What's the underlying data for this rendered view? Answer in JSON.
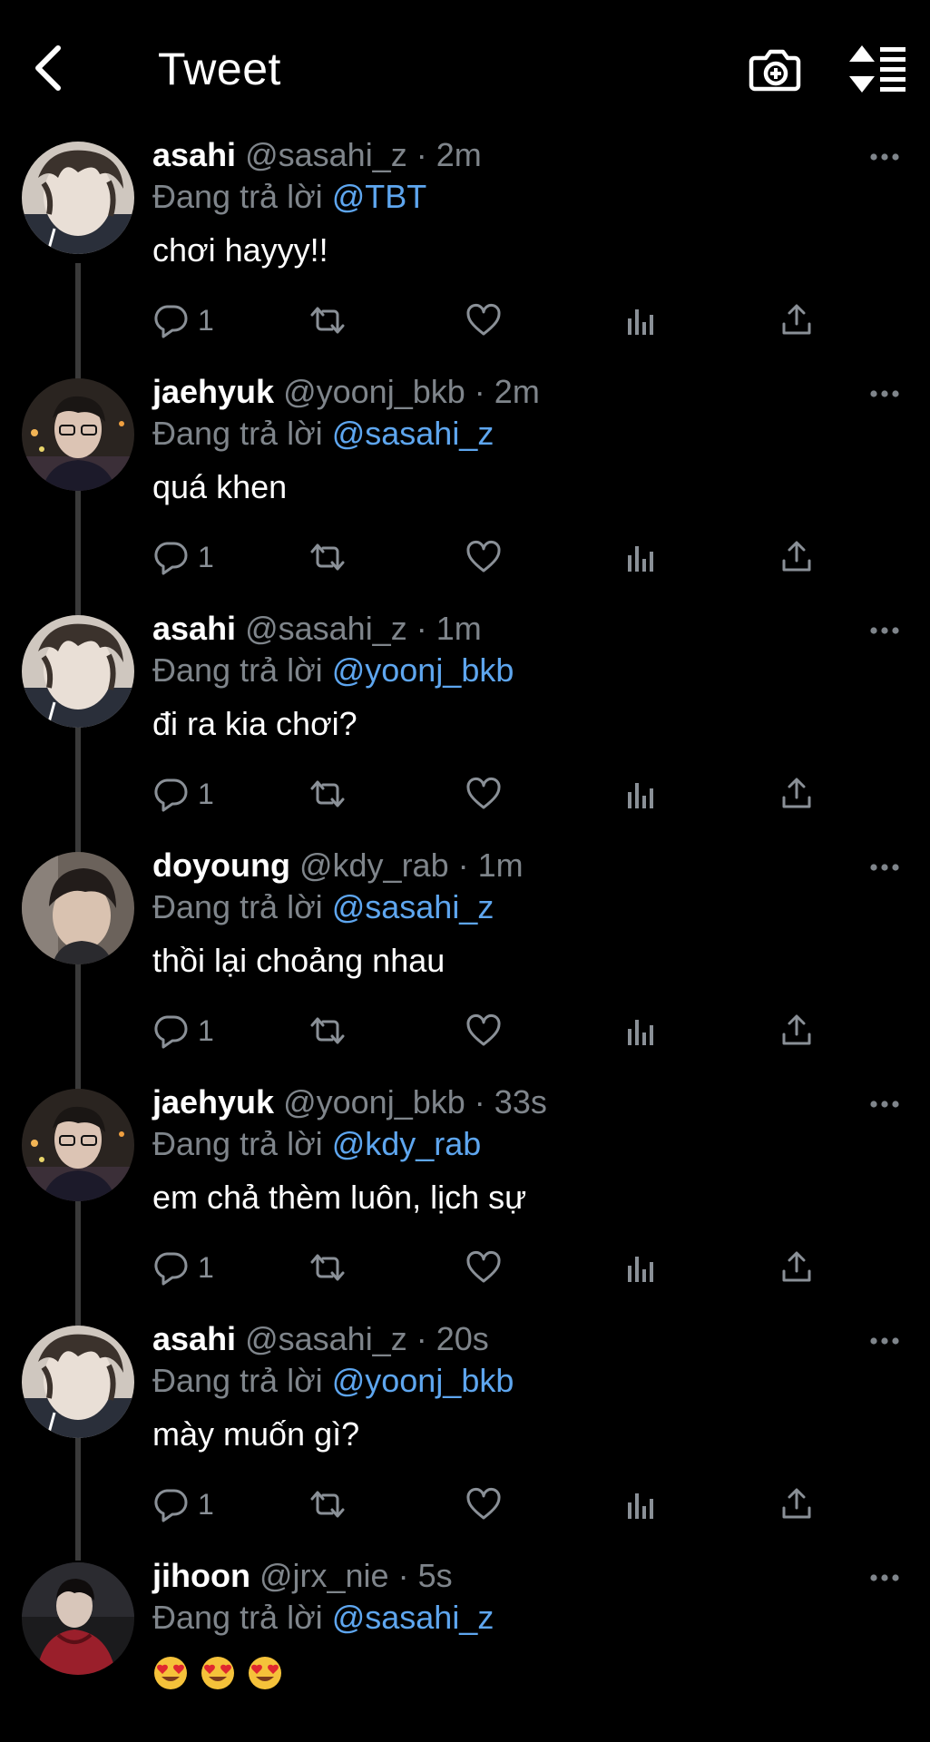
{
  "header": {
    "title": "Tweet"
  },
  "tweets": [
    {
      "name": "asahi",
      "handle": "@sasahi_z",
      "time": "2m",
      "replying_prefix": "Đang trả lời",
      "mention": "@TBT",
      "text": "chơi hayyy!!",
      "reply_count": "1"
    },
    {
      "name": "jaehyuk",
      "handle": "@yoonj_bkb",
      "time": "2m",
      "replying_prefix": "Đang trả lời",
      "mention": "@sasahi_z",
      "text": "quá khen",
      "reply_count": "1"
    },
    {
      "name": "asahi",
      "handle": "@sasahi_z",
      "time": "1m",
      "replying_prefix": "Đang trả lời",
      "mention": "@yoonj_bkb",
      "text": "đi ra kia chơi?",
      "reply_count": "1"
    },
    {
      "name": "doyoung",
      "handle": "@kdy_rab",
      "time": "1m",
      "replying_prefix": "Đang trả lời",
      "mention": "@sasahi_z",
      "text": "thồi lại choảng nhau",
      "reply_count": "1"
    },
    {
      "name": "jaehyuk",
      "handle": "@yoonj_bkb",
      "time": "33s",
      "replying_prefix": "Đang trả lời",
      "mention": "@kdy_rab",
      "text": "em chả thèm luôn, lịch sự",
      "reply_count": "1"
    },
    {
      "name": "asahi",
      "handle": "@sasahi_z",
      "time": "20s",
      "replying_prefix": "Đang trả lời",
      "mention": "@yoonj_bkb",
      "text": "mày muốn gì?",
      "reply_count": "1"
    },
    {
      "name": "jihoon",
      "handle": "@jrx_nie",
      "time": "5s",
      "replying_prefix": "Đang trả lời",
      "mention": "@sasahi_z",
      "emoji": "😍 😍 😍"
    }
  ],
  "separator": "·",
  "colors": {
    "background": "#000000",
    "text": "#ffffff",
    "muted": "#7f858b",
    "mention": "#5ea6ef",
    "thread_line": "#3a3a3a"
  },
  "icons": [
    "back-arrow-icon",
    "camera-plus-icon",
    "sort-icon",
    "more-icon",
    "reply-icon",
    "retweet-icon",
    "like-icon",
    "analytics-icon",
    "share-icon",
    "heart-eyes-emoji-icon"
  ]
}
